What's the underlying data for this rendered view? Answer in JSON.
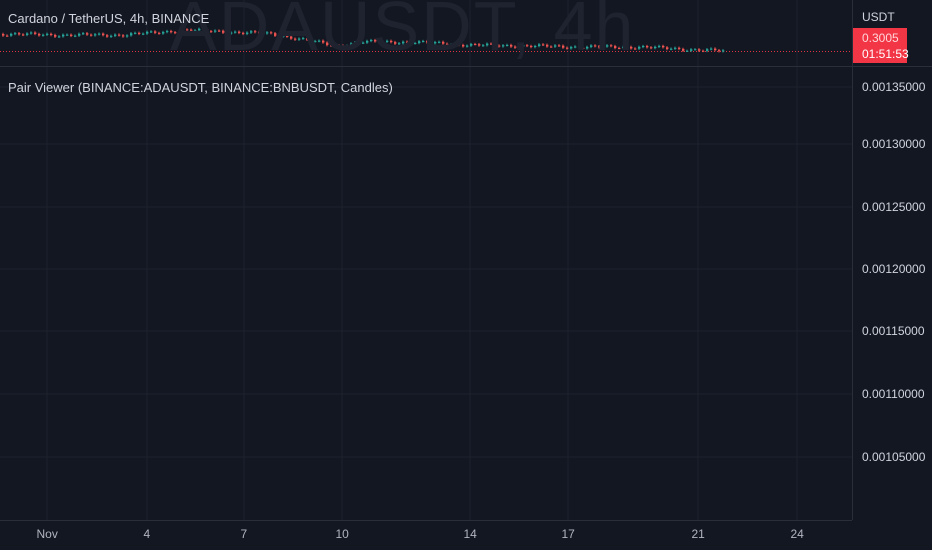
{
  "chart_data": {
    "type": "candlestick",
    "symbol_title": "Cardano / TetherUS, 4h, BINANCE",
    "watermark": "ADAUSDT, 4h",
    "currency": "USDT",
    "last_price": "0.3005",
    "countdown": "01:51:53",
    "indicator_title": "Pair Viewer (BINANCE:ADAUSDT, BINANCE:BNBUSDT, Candles)",
    "indicator_ticks": [
      "0.00135000",
      "0.00130000",
      "0.00125000",
      "0.00120000",
      "0.00115000",
      "0.00110000",
      "0.00105000"
    ],
    "time_ticks": [
      "Nov",
      "4",
      "7",
      "10",
      "14",
      "17",
      "21",
      "24"
    ],
    "colors": {
      "up": "#26a69a",
      "down": "#ef5350",
      "last_price_bg": "#f23645",
      "background": "#131722",
      "grid": "#1e222d"
    }
  }
}
